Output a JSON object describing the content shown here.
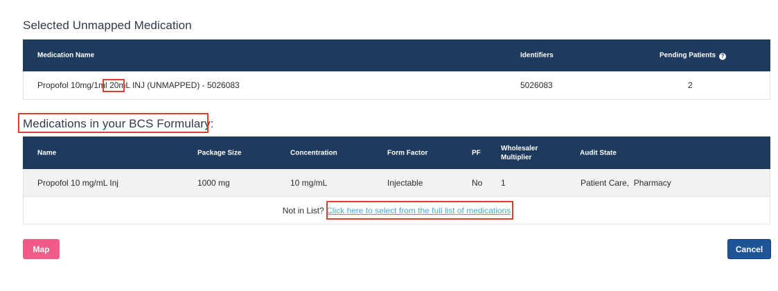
{
  "unmapped": {
    "title": "Selected Unmapped Medication",
    "headers": {
      "name": "Medication Name",
      "identifiers": "Identifiers",
      "pending": "Pending Patients"
    },
    "row": {
      "name_prefix": "Propofol 10mg/1ml ",
      "name_highlight": "20mL",
      "name_suffix": " INJ (UNMAPPED) - 5026083",
      "identifiers": "5026083",
      "pending": "2"
    }
  },
  "formulary": {
    "title": "Medications in your BCS Formulary:",
    "headers": {
      "name": "Name",
      "package_size": "Package Size",
      "concentration": "Concentration",
      "form_factor": "Form Factor",
      "pf": "PF",
      "wholesaler_line1": "Wholesaler",
      "wholesaler_line2": "Multiplier",
      "audit_state": "Audit State"
    },
    "rows": [
      {
        "name": "Propofol 10 mg/mL Inj",
        "package_size": "1000 mg",
        "concentration": "10 mg/mL",
        "form_factor": "Injectable",
        "pf": "No",
        "wholesaler_multiplier": "1",
        "audit_state": "Patient Care,  Pharmacy"
      }
    ],
    "not_in_list": "Not in List?",
    "full_list_link": "Click here to select from the full list of medications"
  },
  "buttons": {
    "map": "Map",
    "cancel": "Cancel"
  },
  "colors": {
    "header_bg": "#1e3a5c",
    "highlight_border": "#d9432b",
    "map_button": "#ef5c8a",
    "cancel_button": "#1e5599",
    "link": "#4aa8d8"
  },
  "icons": {
    "pending_help": "question-circle-icon"
  }
}
